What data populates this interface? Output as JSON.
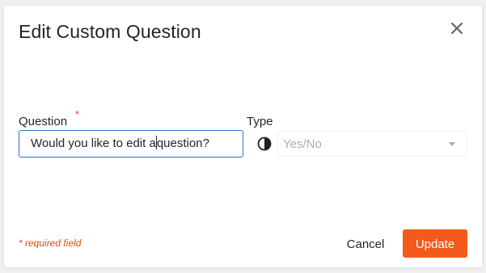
{
  "dialog": {
    "title": "Edit Custom Question",
    "close_icon": "close-icon"
  },
  "form": {
    "question": {
      "label": "Question",
      "required_marker": "*",
      "value_before_caret": "Would you like to edit a",
      "value_after_caret": "question?"
    },
    "type": {
      "label": "Type",
      "icon": "half-circle-contrast-icon",
      "selected_value": "Yes/No",
      "disabled": true
    }
  },
  "footer": {
    "required_note": "* required field",
    "cancel_label": "Cancel",
    "update_label": "Update"
  },
  "colors": {
    "accent": "#f45a1c",
    "focus_border": "#2f6fd6",
    "required": "#e8471c"
  }
}
